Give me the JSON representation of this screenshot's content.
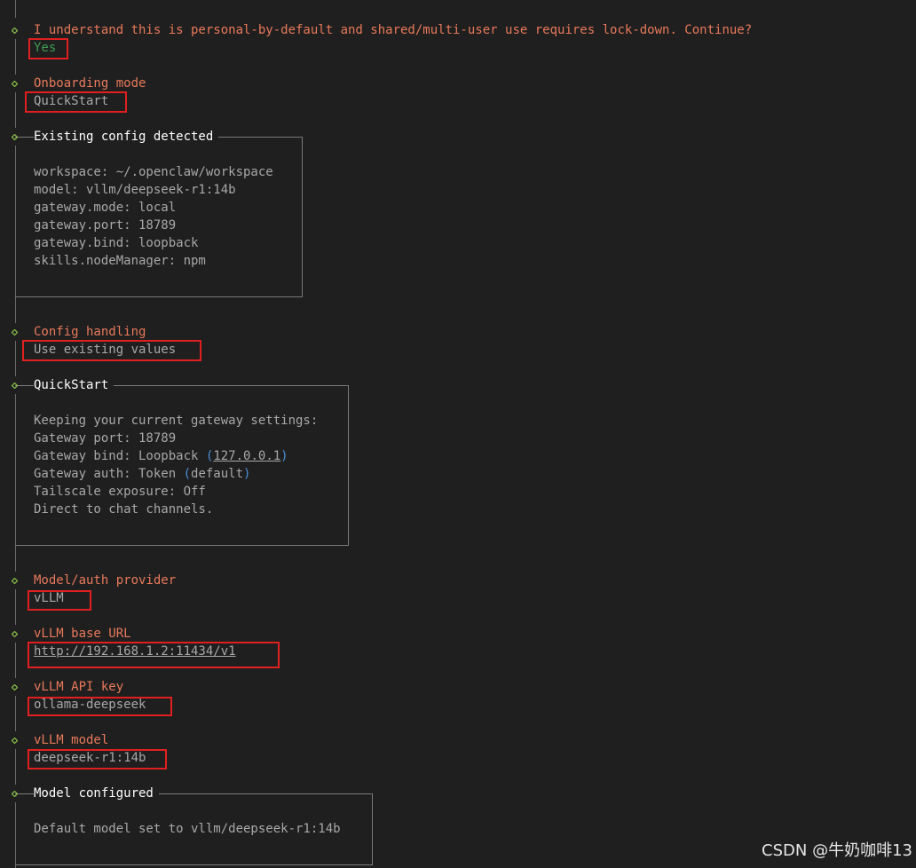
{
  "prompts": [
    {
      "question": "I understand this is personal-by-default and shared/multi-user use requires lock-down. Continue?",
      "answer": "Yes"
    },
    {
      "question": "Onboarding mode",
      "answer": "QuickStart"
    },
    {
      "question": "Config handling",
      "answer": "Use existing values"
    },
    {
      "question": "Model/auth provider",
      "answer": "vLLM"
    },
    {
      "question": "vLLM base URL",
      "answer": "http://192.168.1.2:11434/v1"
    },
    {
      "question": "vLLM API key",
      "answer": "ollama-deepseek"
    },
    {
      "question": "vLLM model",
      "answer": "deepseek-r1:14b"
    }
  ],
  "existing_config": {
    "title": "Existing config detected",
    "lines": [
      "workspace: ~/.openclaw/workspace",
      "model: vllm/deepseek-r1:14b",
      "gateway.mode: local",
      "gateway.port: 18789",
      "gateway.bind: loopback",
      "skills.nodeManager: npm"
    ]
  },
  "quickstart": {
    "title": "QuickStart",
    "line1": "Keeping your current gateway settings:",
    "line2": "Gateway port: 18789",
    "bind_label": "Gateway bind: Loopback ",
    "bind_paren_open": "(",
    "bind_ip": "127.0.0.1",
    "bind_paren_close": ")",
    "auth_label": "Gateway auth: Token ",
    "auth_paren_open": "(",
    "auth_default": "default",
    "auth_paren_close": ")",
    "line5": "Tailscale exposure: Off",
    "line6": "Direct to chat channels."
  },
  "model_configured": {
    "title": "Model configured",
    "line1": "Default model set to vllm/deepseek-r1:14b"
  },
  "watermark": "CSDN @牛奶咖啡13",
  "colors": {
    "background": "#1f1f1f",
    "question": "#e8795a",
    "diamond": "#8bc34a",
    "highlight": "#e02020",
    "yes": "#3f9b52",
    "link_blue": "#4a90d9"
  }
}
